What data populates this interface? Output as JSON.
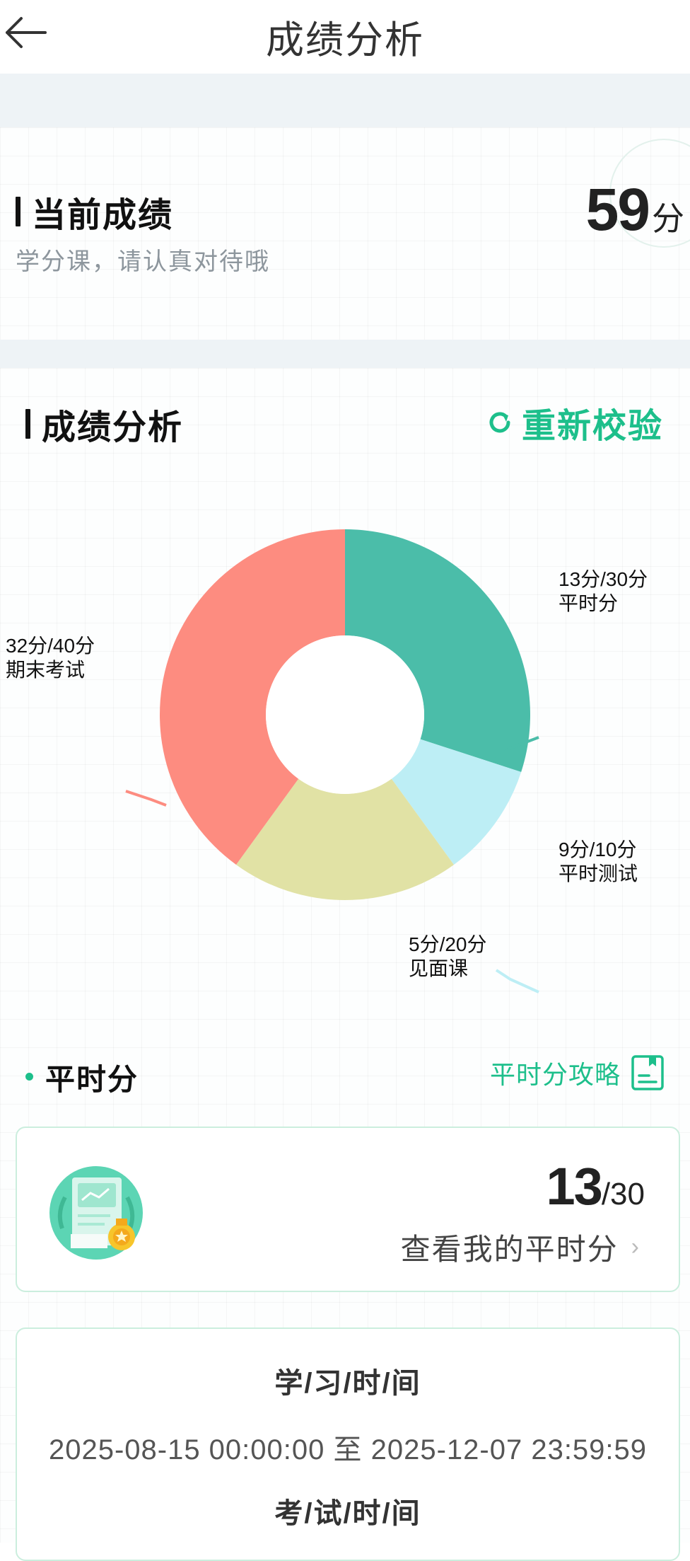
{
  "header": {
    "title": "成绩分析"
  },
  "current_score": {
    "title": "当前成绩",
    "subtitle": "学分课，请认真对待哦",
    "value": "59",
    "unit": "分"
  },
  "analysis": {
    "title": "成绩分析",
    "recheck_label": "重新校验"
  },
  "chart_data": {
    "type": "pie",
    "donut": true,
    "slices": [
      {
        "score": "13分/30分",
        "name": "平时分",
        "weight": 30,
        "color": "#4bbda9"
      },
      {
        "score": "9分/10分",
        "name": "平时测试",
        "weight": 10,
        "color": "#bdeef5"
      },
      {
        "score": "5分/20分",
        "name": "见面课",
        "weight": 20,
        "color": "#e1e2a5"
      },
      {
        "score": "32分/40分",
        "name": "期末考试",
        "weight": 40,
        "color": "#fd8c80"
      }
    ]
  },
  "normal_section": {
    "title": "平时分",
    "strategy_label": "平时分攻略",
    "score": "13",
    "total": "/30",
    "link_label": "查看我的平时分"
  },
  "schedule": {
    "study_time_label": "学/习/时/间",
    "study_time_range": "2025-08-15 00:00:00 至 2025-12-07 23:59:59",
    "exam_time_label": "考/试/时/间"
  },
  "colors": {
    "accent": "#1dbf8b"
  }
}
